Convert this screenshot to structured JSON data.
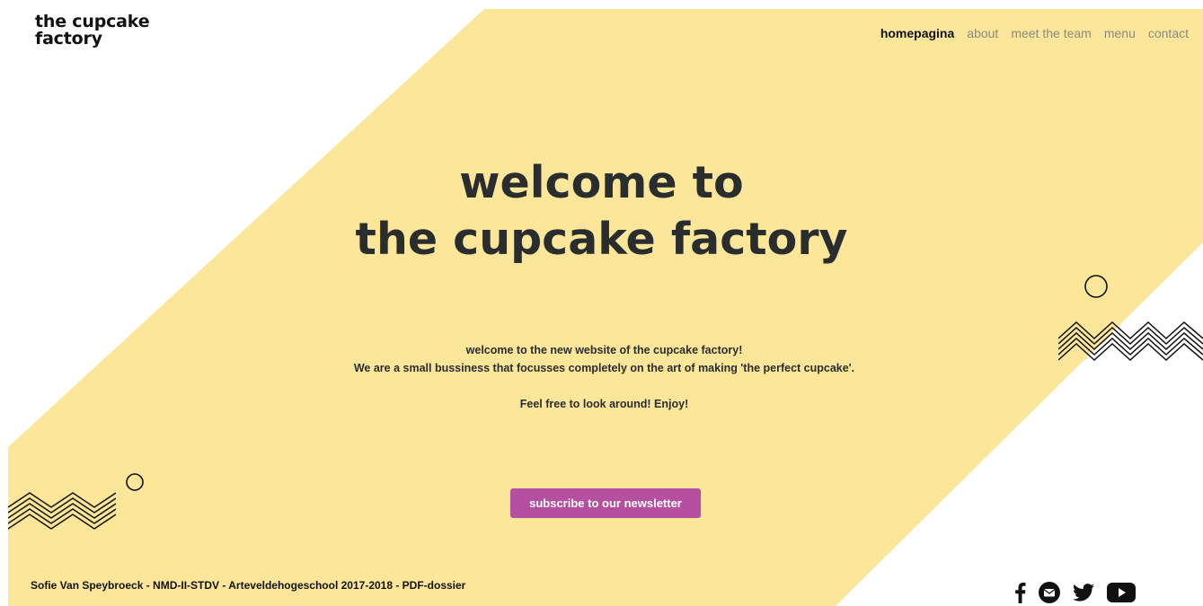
{
  "logo": {
    "line1": "the cupcake",
    "line2": "factory"
  },
  "nav": {
    "items": [
      {
        "label": "homepagina",
        "active": true
      },
      {
        "label": "about",
        "active": false
      },
      {
        "label": "meet the team",
        "active": false
      },
      {
        "label": "menu",
        "active": false
      },
      {
        "label": "contact",
        "active": false
      }
    ]
  },
  "hero": {
    "title_line1": "welcome to",
    "title_line2": "the cupcake factory"
  },
  "intro": {
    "line1": "welcome to the new website of the cupcake factory!",
    "line2": "We are a small bussiness that focusses completely on the art of making 'the perfect cupcake'.",
    "line3": "Feel free to look around! Enjoy!"
  },
  "cta": {
    "label": "subscribe to our newsletter"
  },
  "footer": {
    "credit": "Sofie Van Speybroeck - NMD-II-STDV - Arteveldehogeschool 2017-2018 - PDF-dossier",
    "social_icons": [
      "facebook-icon",
      "mail-icon",
      "twitter-icon",
      "youtube-icon"
    ]
  },
  "colors": {
    "background": "#ffffff",
    "shape": "#fce69a",
    "text": "#2a2d2e",
    "nav_inactive": "#8a8a80",
    "button": "#b64f9f",
    "button_text": "#ffffff"
  }
}
